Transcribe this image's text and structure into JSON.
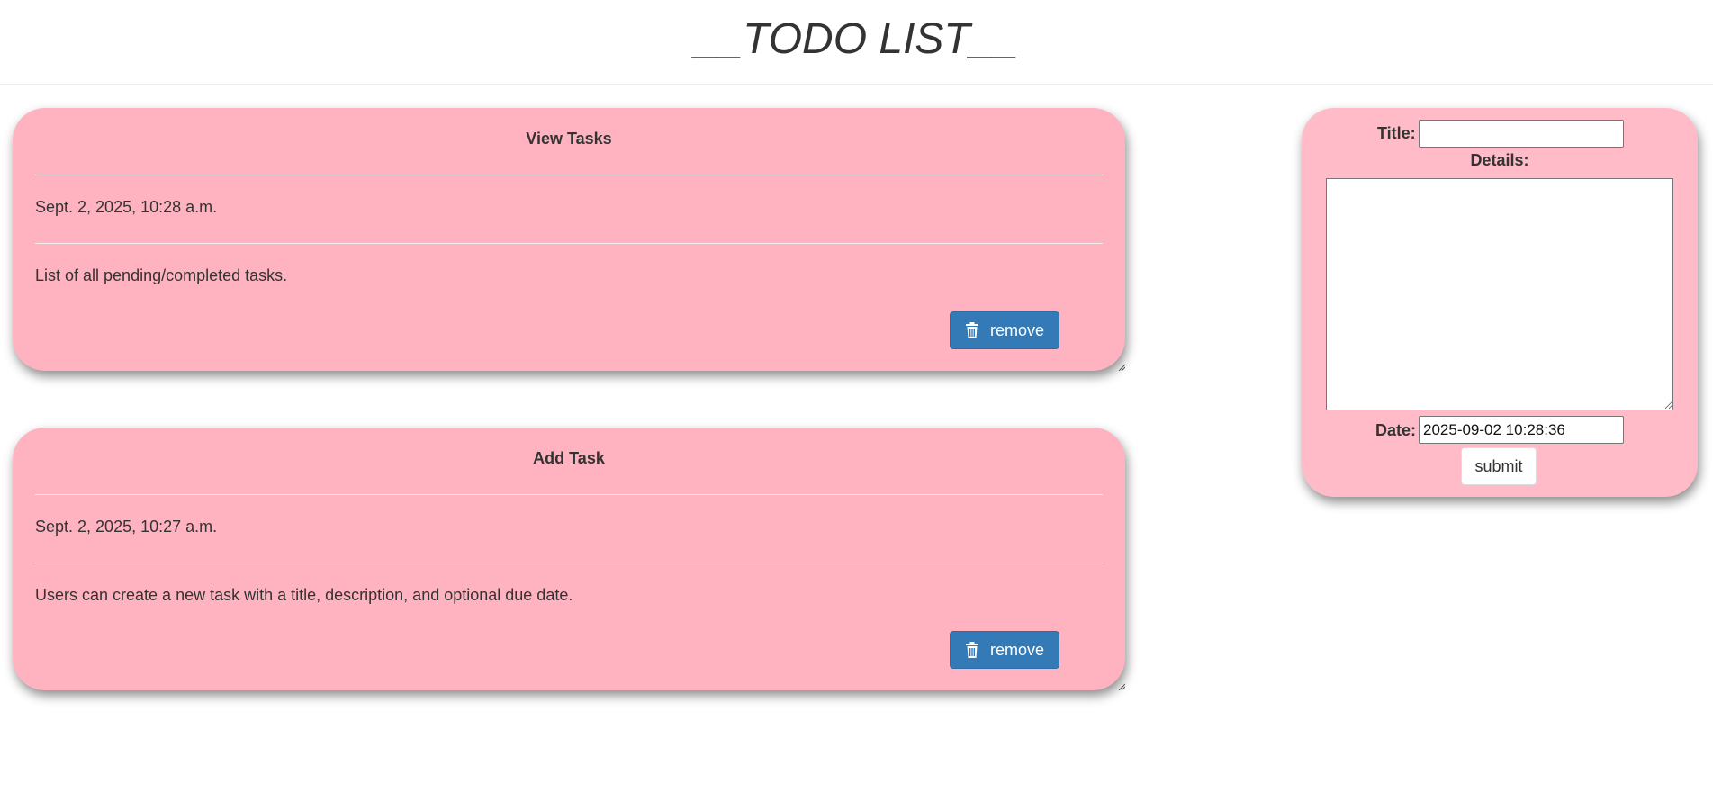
{
  "header": {
    "title": "__TODO LIST__"
  },
  "tasks": [
    {
      "title": "View Tasks",
      "date": "Sept. 2, 2025, 10:28 a.m.",
      "description": "List of all pending/completed tasks.",
      "remove_label": "remove",
      "remove_icon": "trash-icon"
    },
    {
      "title": "Add Task",
      "date": "Sept. 2, 2025, 10:27 a.m.",
      "description": "Users can create a new task with a title, description, and optional due date.",
      "remove_label": "remove",
      "remove_icon": "trash-icon"
    }
  ],
  "form": {
    "title_label": "Title:",
    "title_value": "",
    "details_label": "Details:",
    "details_value": "",
    "date_label": "Date:",
    "date_value": "2025-09-02 10:28:36",
    "submit_label": "submit"
  },
  "colors": {
    "card_bg": "#ffb3c0",
    "button_primary": "#337ab7",
    "text": "#333333"
  }
}
